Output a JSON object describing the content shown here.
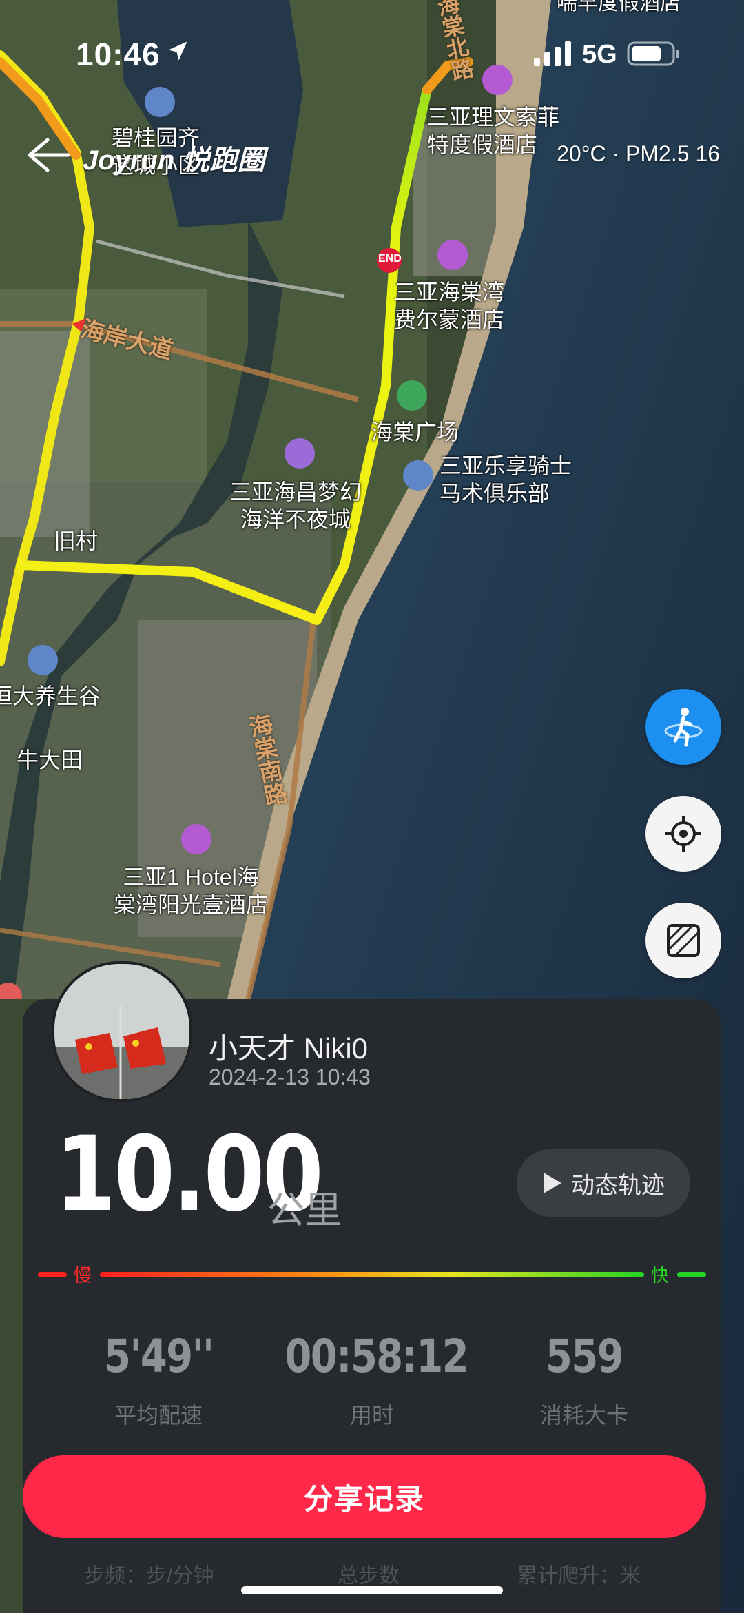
{
  "status_bar": {
    "time": "10:46",
    "network": "5G"
  },
  "header": {
    "brand": "Joyrun 悦跑圈",
    "weather": "20°C · PM2.5 16"
  },
  "map_labels": {
    "poi_1": "三亚理文索菲\n特度假酒店",
    "poi_2": "三亚海棠湾\n费尔蒙酒店",
    "poi_3": "海棠广场",
    "poi_4": "三亚乐享骑士\n马术俱乐部",
    "poi_5": "三亚海昌梦幻\n海洋不夜城",
    "poi_6": "旧村",
    "poi_7": "恒大养生谷",
    "poi_8": "牛大田",
    "poi_9": "三亚1 Hotel海\n棠湾阳光壹酒店",
    "poi_10": "碧桂园齐\n这城小区",
    "road_1": "海岸大道",
    "road_2": "海棠南路",
    "road_3": "海棠北路",
    "top_clip": "喘早度假酒店",
    "end_marker": "END"
  },
  "record": {
    "username": "小天才 Niki0",
    "datetime": "2024-2-13 10:43",
    "distance": "10.00",
    "distance_unit": "公里",
    "replay_label": "动态轨迹",
    "slow_label": "慢",
    "fast_label": "快",
    "stats": [
      {
        "value": "5'49''",
        "label": "平均配速"
      },
      {
        "value": "00:58:12",
        "label": "用时"
      },
      {
        "value": "559",
        "label": "消耗大卡"
      }
    ],
    "share_label": "分享记录",
    "below_items": [
      "步频：步/分钟",
      "总步数",
      "累计爬升：米"
    ]
  },
  "colors": {
    "accent": "#ff2848",
    "fab_blue": "#1c8ff0",
    "card_bg": "#26292d"
  }
}
